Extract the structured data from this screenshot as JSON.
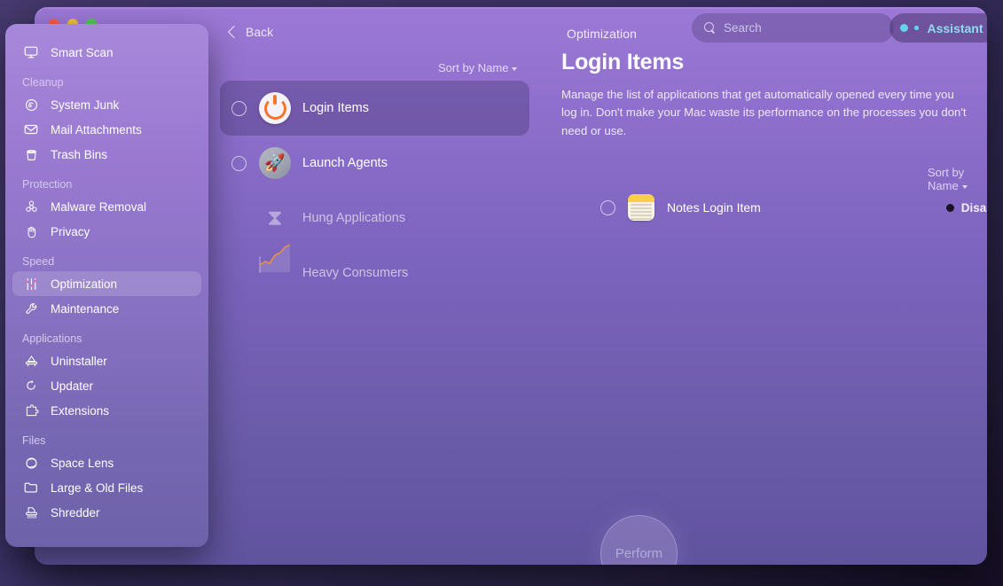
{
  "window": {
    "title": "Optimization",
    "back_label": "Back",
    "traffic_lights": [
      "close",
      "minimize",
      "zoom"
    ]
  },
  "search": {
    "placeholder": "Search",
    "value": "",
    "icon": "search-icon"
  },
  "assistant": {
    "label": "Assistant",
    "accent": "#8fdcef"
  },
  "sidebar": {
    "top_items": [
      {
        "label": "Smart Scan",
        "icon": "smart-scan-icon",
        "active": false
      }
    ],
    "groups": [
      {
        "title": "Cleanup",
        "items": [
          {
            "label": "System Junk",
            "icon": "system-junk-icon",
            "active": false
          },
          {
            "label": "Mail Attachments",
            "icon": "mail-icon",
            "active": false
          },
          {
            "label": "Trash Bins",
            "icon": "trash-icon",
            "active": false
          }
        ]
      },
      {
        "title": "Protection",
        "items": [
          {
            "label": "Malware Removal",
            "icon": "biohazard-icon",
            "active": false
          },
          {
            "label": "Privacy",
            "icon": "hand-icon",
            "active": false
          }
        ]
      },
      {
        "title": "Speed",
        "items": [
          {
            "label": "Optimization",
            "icon": "sliders-icon",
            "active": true
          },
          {
            "label": "Maintenance",
            "icon": "wrench-icon",
            "active": false
          }
        ]
      },
      {
        "title": "Applications",
        "items": [
          {
            "label": "Uninstaller",
            "icon": "uninstaller-icon",
            "active": false
          },
          {
            "label": "Updater",
            "icon": "updater-icon",
            "active": false
          },
          {
            "label": "Extensions",
            "icon": "puzzle-icon",
            "active": false
          }
        ]
      },
      {
        "title": "Files",
        "items": [
          {
            "label": "Space Lens",
            "icon": "space-lens-icon",
            "active": false
          },
          {
            "label": "Large & Old Files",
            "icon": "folder-icon",
            "active": false
          },
          {
            "label": "Shredder",
            "icon": "shredder-icon",
            "active": false
          }
        ]
      }
    ]
  },
  "modules": {
    "sort_label": "Sort by Name",
    "items": [
      {
        "label": "Login Items",
        "icon": "power-icon",
        "selected": true,
        "enabled": true
      },
      {
        "label": "Launch Agents",
        "icon": "rocket-icon",
        "selected": false,
        "enabled": true
      },
      {
        "label": "Hung Applications",
        "icon": "hourglass-icon",
        "selected": false,
        "enabled": false
      },
      {
        "label": "Heavy Consumers",
        "icon": "chart-icon",
        "selected": false,
        "enabled": false
      }
    ]
  },
  "detail": {
    "title": "Login Items",
    "description": "Manage the list of applications that get automatically opened every time you log in. Don't make your Mac waste its performance on the processes you don't need or use.",
    "sort_label": "Sort by Name",
    "rows": [
      {
        "name": "Notes Login Item",
        "icon": "notes-icon",
        "status": "Disabled",
        "status_color": "#1a1326"
      }
    ]
  },
  "perform": {
    "label": "Perform"
  }
}
